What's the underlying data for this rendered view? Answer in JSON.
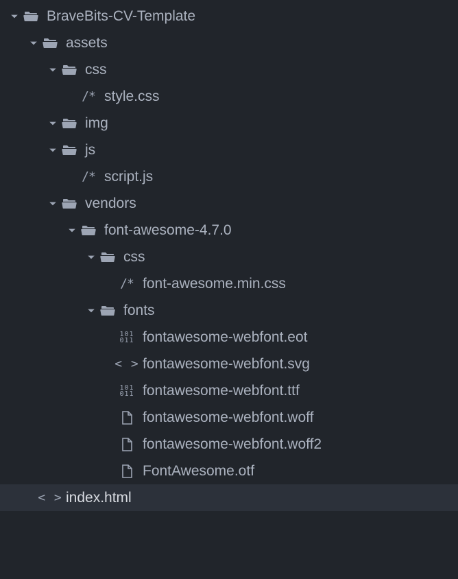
{
  "tree": {
    "root": {
      "name": "BraveBits-CV-Template",
      "type": "folder",
      "expanded": true,
      "children": [
        {
          "name": "assets",
          "type": "folder",
          "expanded": true,
          "children": [
            {
              "name": "css",
              "type": "folder",
              "expanded": true,
              "children": [
                {
                  "name": "style.css",
                  "type": "file",
                  "icon": "comment"
                }
              ]
            },
            {
              "name": "img",
              "type": "folder",
              "expanded": true,
              "children": []
            },
            {
              "name": "js",
              "type": "folder",
              "expanded": true,
              "children": [
                {
                  "name": "script.js",
                  "type": "file",
                  "icon": "comment"
                }
              ]
            },
            {
              "name": "vendors",
              "type": "folder",
              "expanded": true,
              "children": [
                {
                  "name": "font-awesome-4.7.0",
                  "type": "folder",
                  "expanded": true,
                  "children": [
                    {
                      "name": "css",
                      "type": "folder",
                      "expanded": true,
                      "children": [
                        {
                          "name": "font-awesome.min.css",
                          "type": "file",
                          "icon": "comment"
                        }
                      ]
                    },
                    {
                      "name": "fonts",
                      "type": "folder",
                      "expanded": true,
                      "children": [
                        {
                          "name": "fontawesome-webfont.eot",
                          "type": "file",
                          "icon": "binary"
                        },
                        {
                          "name": "fontawesome-webfont.svg",
                          "type": "file",
                          "icon": "code"
                        },
                        {
                          "name": "fontawesome-webfont.ttf",
                          "type": "file",
                          "icon": "binary"
                        },
                        {
                          "name": "fontawesome-webfont.woff",
                          "type": "file",
                          "icon": "doc"
                        },
                        {
                          "name": "fontawesome-webfont.woff2",
                          "type": "file",
                          "icon": "doc"
                        },
                        {
                          "name": "FontAwesome.otf",
                          "type": "file",
                          "icon": "doc"
                        }
                      ]
                    }
                  ]
                }
              ]
            }
          ]
        },
        {
          "name": "index.html",
          "type": "file",
          "icon": "code",
          "selected": true
        }
      ]
    }
  },
  "indent_base": 12,
  "indent_step": 28
}
